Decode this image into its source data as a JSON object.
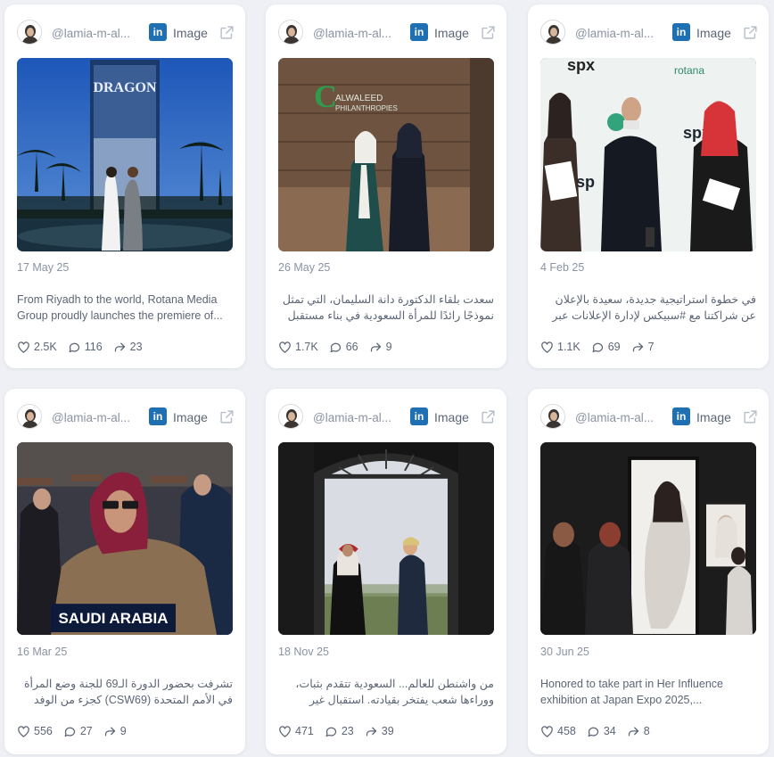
{
  "posts": [
    {
      "author": "@lamia-m-al...",
      "network": "in",
      "type": "Image",
      "date": "17 May 25",
      "caption": "From Riyadh to the world, Rotana Media Group proudly launches the premiere of...",
      "likes": "2.5K",
      "comments": "116",
      "shares": "23",
      "rtl": false,
      "photo_text": "DRAGON"
    },
    {
      "author": "@lamia-m-al...",
      "network": "in",
      "type": "Image",
      "date": "26 May 25",
      "caption": "سعدت بلقاء الدكتورة دانة السليمان، التي تمثل نموذجًا رائدًا للمرأة السعودية في بناء مستقبل علمي...",
      "likes": "1.7K",
      "comments": "66",
      "shares": "9",
      "rtl": true,
      "photo_text": "ALWALEED PHILANTHROPIES"
    },
    {
      "author": "@lamia-m-al...",
      "network": "in",
      "type": "Image",
      "date": "4 Feb 25",
      "caption": "في خطوة استراتيجية جديدة، سعيدة بالإعلان عن شراكتنا مع #سبيكس لإدارة الإعلانات عبر قنوات...",
      "likes": "1.1K",
      "comments": "69",
      "shares": "7",
      "rtl": true,
      "photo_text": "spx"
    },
    {
      "author": "@lamia-m-al...",
      "network": "in",
      "type": "Image",
      "date": "16 Mar 25",
      "caption": "تشرفت بحضور الدورة الـ69 للجنة وضع المرأة في الأمم المتحدة (CSW69) كجزء من الوفد السعودي...",
      "likes": "556",
      "comments": "27",
      "shares": "9",
      "rtl": true,
      "photo_text": "SAUDI ARABIA"
    },
    {
      "author": "@lamia-m-al...",
      "network": "in",
      "type": "Image",
      "date": "18 Nov 25",
      "caption": "من واشنطن للعالم... السعودية تتقدم بثبات، ووراءها شعب يفتخر بقيادته. استقبال غير مسبوق يليق...",
      "likes": "471",
      "comments": "23",
      "shares": "39",
      "rtl": true,
      "photo_text": ""
    },
    {
      "author": "@lamia-m-al...",
      "network": "in",
      "type": "Image",
      "date": "30 Jun 25",
      "caption": "Honored to take part in Her Influence exhibition at Japan Expo 2025,...",
      "likes": "458",
      "comments": "34",
      "shares": "8",
      "rtl": false,
      "photo_text": ""
    }
  ],
  "icons": {
    "avatar": "avatar-icon",
    "network": "linkedin-icon",
    "external": "external-link-icon",
    "like": "heart-icon",
    "comment": "comment-icon",
    "share": "share-icon"
  },
  "colors": {
    "linkedin": "#1f6fb3",
    "background": "#eef0f5",
    "card": "#ffffff"
  }
}
